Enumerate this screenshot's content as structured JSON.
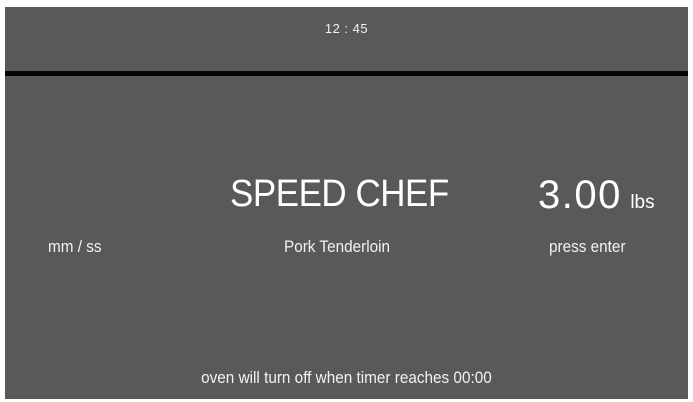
{
  "header": {
    "clock": "12 : 45"
  },
  "main": {
    "mode_title": "SPEED CHEF",
    "weight_value": "3.00",
    "weight_unit": "lbs",
    "time_units_label": "mm / ss",
    "recipe_name": "Pork Tenderloin",
    "action_hint": "press enter"
  },
  "footer": {
    "note": "oven will turn off when timer reaches 00:00"
  },
  "colors": {
    "panel_background": "#59595b",
    "divider": "#050505",
    "text": "#ffffff"
  }
}
